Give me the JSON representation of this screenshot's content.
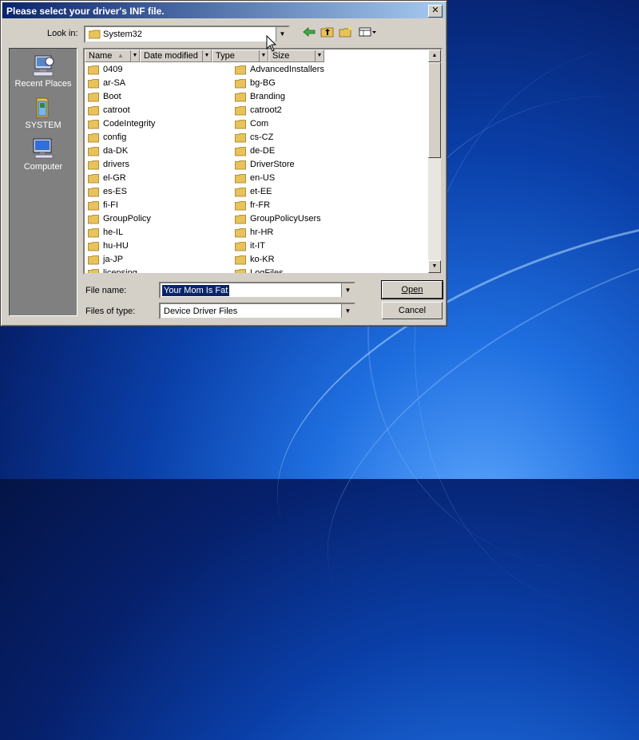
{
  "dialog": {
    "title": "Please select your driver's INF file.",
    "close_glyph": "✕"
  },
  "lookin": {
    "label": "Look in:",
    "value": "System32"
  },
  "toolbar": {
    "back_icon": "back-arrow-icon",
    "up_icon": "up-folder-icon",
    "newfolder_icon": "new-folder-icon",
    "view_icon": "view-menu-icon"
  },
  "places": [
    {
      "label": "Recent Places",
      "icon": "recent-places-icon"
    },
    {
      "label": "SYSTEM",
      "icon": "user-folder-icon"
    },
    {
      "label": "Computer",
      "icon": "computer-icon"
    }
  ],
  "columns": [
    {
      "label": "Name"
    },
    {
      "label": "Date modified"
    },
    {
      "label": "Type"
    },
    {
      "label": "Size"
    }
  ],
  "files_left": [
    "0409",
    "ar-SA",
    "Boot",
    "catroot",
    "CodeIntegrity",
    "config",
    "da-DK",
    "drivers",
    "el-GR",
    "es-ES",
    "fi-FI",
    "GroupPolicy",
    "he-IL",
    "hu-HU",
    "ja-JP",
    "licensing"
  ],
  "files_right": [
    "AdvancedInstallers",
    "bg-BG",
    "Branding",
    "catroot2",
    "Com",
    "cs-CZ",
    "de-DE",
    "DriverStore",
    "en-US",
    "et-EE",
    "fr-FR",
    "GroupPolicyUsers",
    "hr-HR",
    "it-IT",
    "ko-KR",
    "LogFiles"
  ],
  "filename": {
    "label": "File name:",
    "value": "Your Mom Is Fat"
  },
  "filetype": {
    "label": "Files of type:",
    "value": "Device Driver Files"
  },
  "buttons": {
    "open": "Open",
    "cancel": "Cancel"
  },
  "colors": {
    "folder": "#e8c25a",
    "title_start": "#0a246a",
    "title_end": "#a6caf0"
  }
}
